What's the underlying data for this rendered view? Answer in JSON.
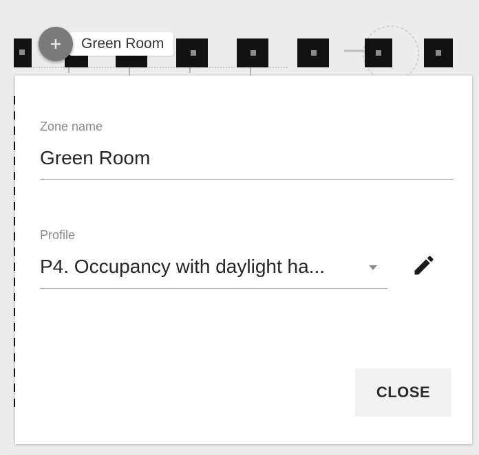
{
  "zone_chip": {
    "label": "Green Room",
    "icon": "plus-icon"
  },
  "dialog": {
    "zone_name": {
      "label": "Zone name",
      "value": "Green Room"
    },
    "profile": {
      "label": "Profile",
      "value": "P4. Occupancy with daylight ha...",
      "caret_icon": "caret-down-icon",
      "edit_icon": "pencil-icon"
    },
    "close_label": "CLOSE"
  },
  "colors": {
    "fixture": "#111111",
    "chip_icon": "#7a7a7a",
    "text": "#262626"
  }
}
